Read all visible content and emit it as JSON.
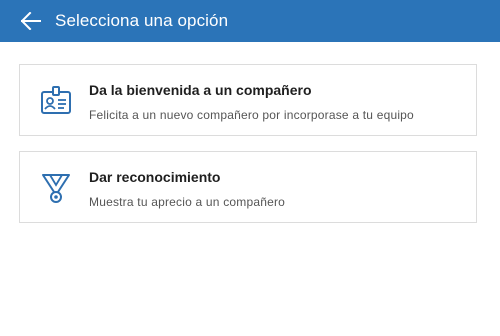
{
  "header": {
    "title": "Selecciona una opción",
    "background": "#2b74b8"
  },
  "options": [
    {
      "icon": "id-badge-icon",
      "title": "Da la bienvenida a un compañero",
      "subtitle": "Felicita a un nuevo compañero por incorporase a tu equipo"
    },
    {
      "icon": "medal-icon",
      "title": "Dar reconocimiento",
      "subtitle": "Muestra tu aprecio a un compañero"
    }
  ],
  "colors": {
    "accent": "#2b74b8",
    "icon": "#2e6fb0"
  }
}
